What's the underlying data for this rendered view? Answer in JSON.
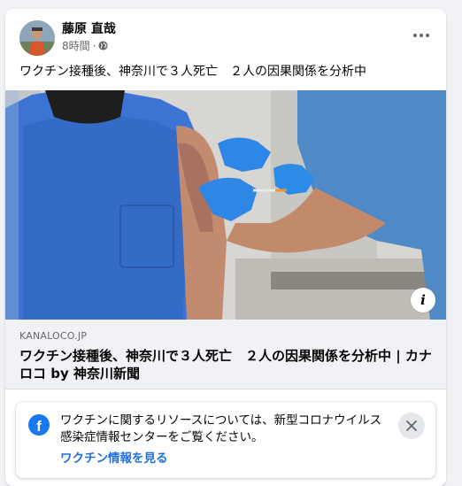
{
  "post": {
    "author": "藤原 直哉",
    "timestamp": "8時間",
    "separator": "·",
    "privacy_icon": "globe-icon",
    "text": "ワクチン接種後、神奈川で３人死亡　２人の因果関係を分析中"
  },
  "link_preview": {
    "domain": "KANALOCO.JP",
    "title": "ワクチン接種後、神奈川で３人死亡　２人の因果関係を分析中 | カナロコ by 神奈川新聞",
    "info_label": "i"
  },
  "notice": {
    "text": "ワクチンに関するリソースについては、新型コロナウイルス感染症情報センターをご覧ください。",
    "link": "ワクチン情報を見る",
    "logo_letter": "f"
  },
  "colors": {
    "accent": "#1877f2",
    "link": "#216fdb",
    "secondary_text": "#65676b",
    "page_bg": "#f0f2f5"
  }
}
